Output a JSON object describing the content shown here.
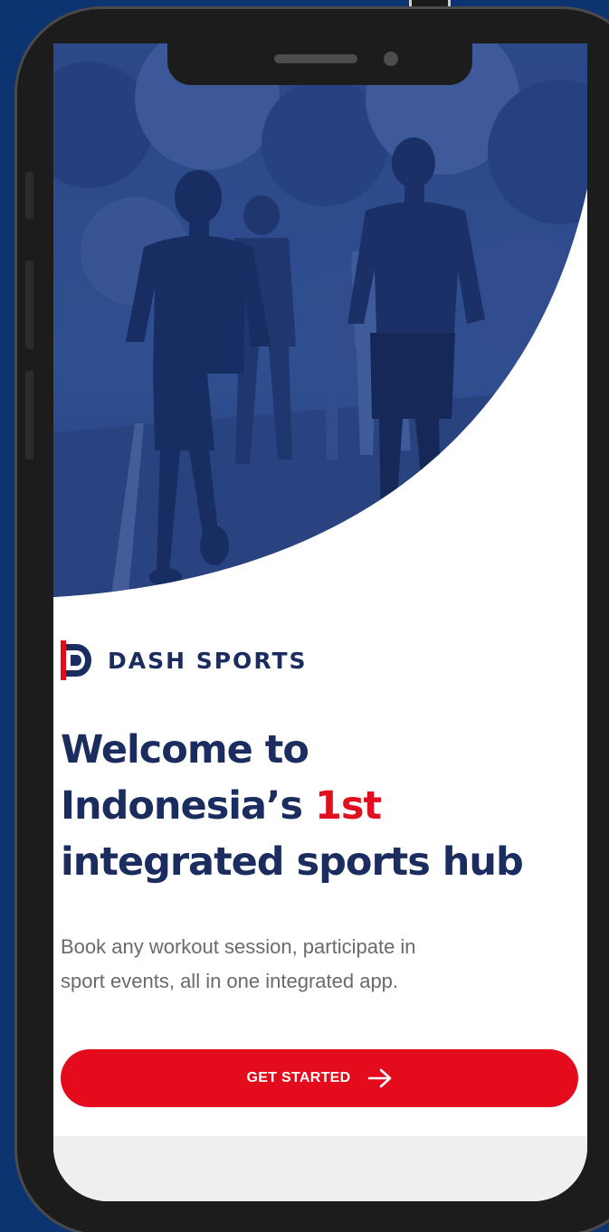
{
  "brand": {
    "name": "DASH SPORTS",
    "logo_icon": "dash-d-logo"
  },
  "welcome": {
    "headline_line1": "Welcome to",
    "headline_line2_prefix": "Indonesia’s ",
    "headline_line2_accent": "1st",
    "headline_line3": "integrated sports hub",
    "subtitle_line1": "Book any workout session, participate in",
    "subtitle_line2": "sport events, all in one integrated app."
  },
  "cta": {
    "label": "GET STARTED",
    "icon": "arrow-right-icon"
  },
  "hero": {
    "image": "runners-photo-navy-tint"
  },
  "colors": {
    "background": "#0b3470",
    "navy": "#1b2d5e",
    "accent_red": "#e30b1c",
    "subtitle_gray": "#6a6a6a"
  }
}
